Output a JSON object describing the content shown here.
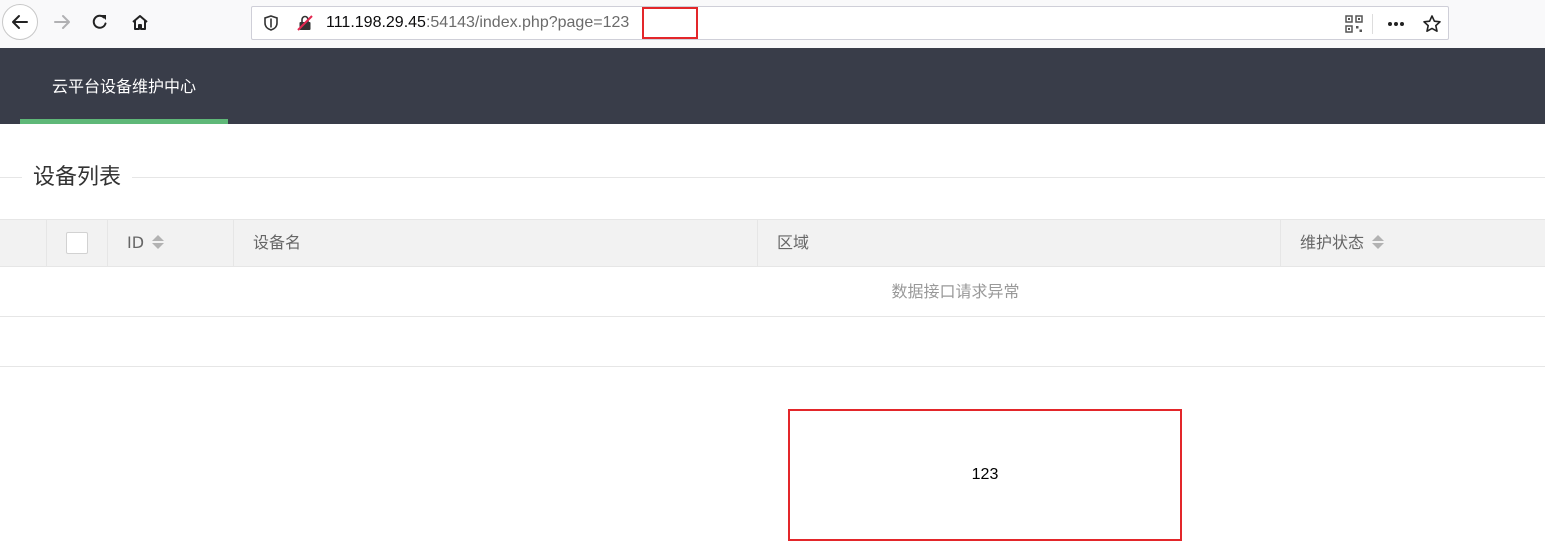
{
  "browser": {
    "url_host": "111.198.29.45",
    "url_rest": ":54143/index.php?page=",
    "url_param": "123"
  },
  "header": {
    "brand": "云平台设备维护中心",
    "accent_color": "#5fb878",
    "bg_color": "#393d49"
  },
  "section": {
    "legend": "设备列表"
  },
  "table": {
    "columns": [
      {
        "label": "ID",
        "sortable": true
      },
      {
        "label": "设备名",
        "sortable": false
      },
      {
        "label": "区域",
        "sortable": false
      },
      {
        "label": "维护状态",
        "sortable": true
      }
    ],
    "empty_text": "数据接口请求异常"
  },
  "output": {
    "value": "123"
  }
}
